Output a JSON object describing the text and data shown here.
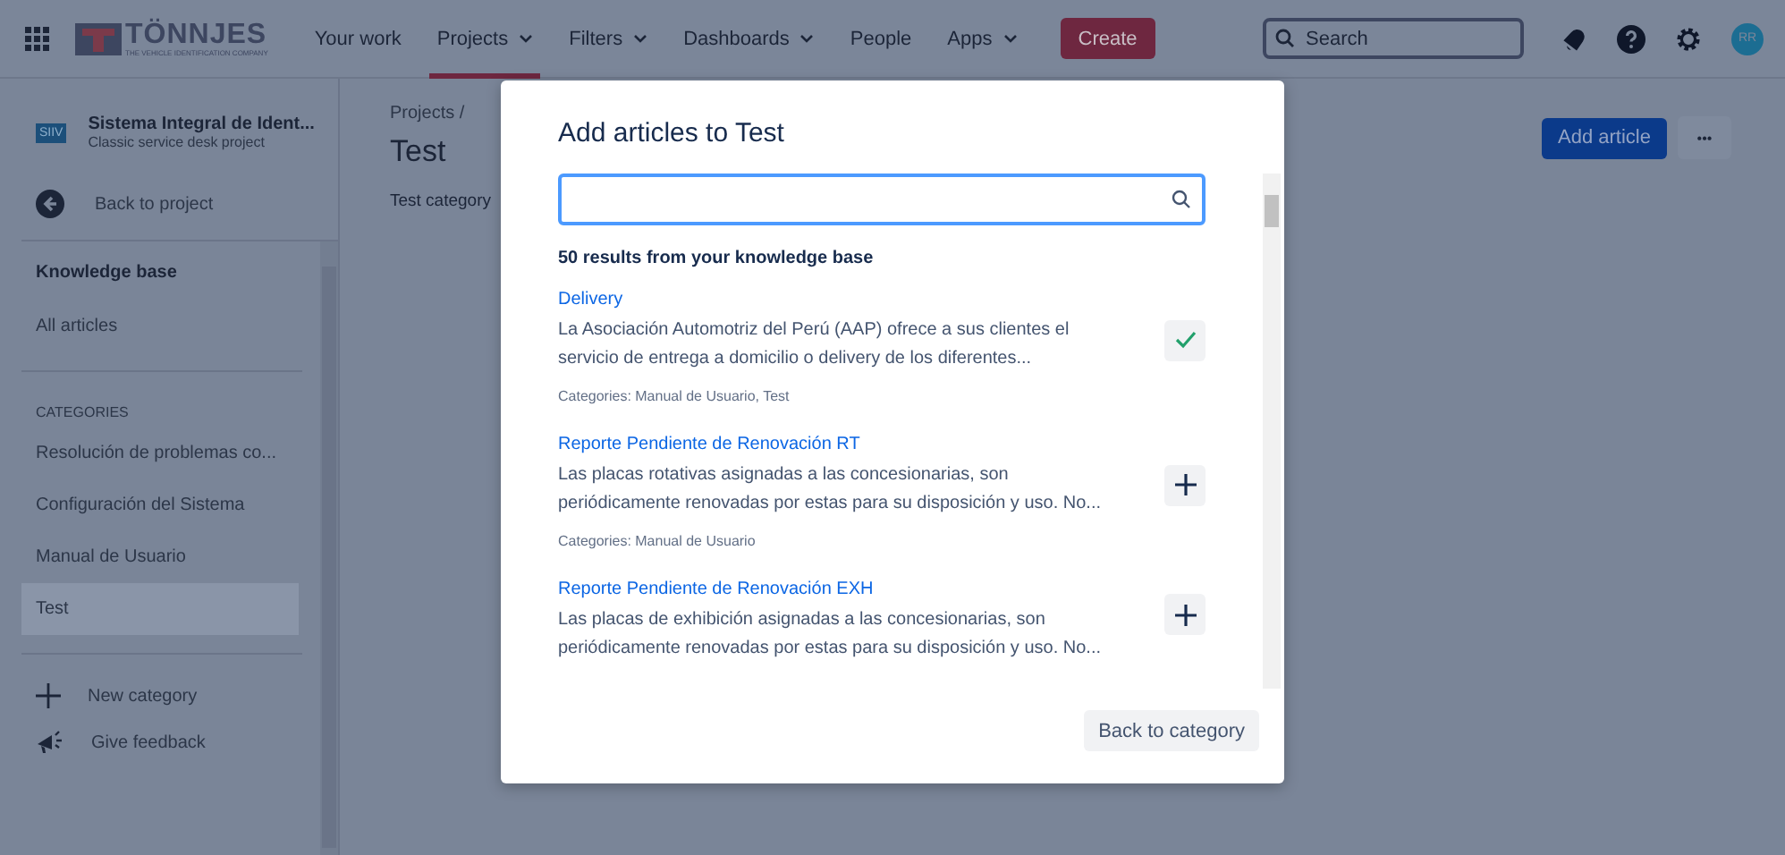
{
  "top_nav": {
    "logo": {
      "name": "TÖNNJES",
      "tagline": "THE VEHICLE IDENTIFICATION COMPANY"
    },
    "items": [
      {
        "label": "Your work",
        "has_menu": false,
        "selected": false
      },
      {
        "label": "Projects",
        "has_menu": true,
        "selected": true
      },
      {
        "label": "Filters",
        "has_menu": true,
        "selected": false
      },
      {
        "label": "Dashboards",
        "has_menu": true,
        "selected": false
      },
      {
        "label": "People",
        "has_menu": false,
        "selected": false
      },
      {
        "label": "Apps",
        "has_menu": true,
        "selected": false
      }
    ],
    "create_button": "Create",
    "search": {
      "placeholder": "Search"
    },
    "avatar": "RR"
  },
  "sidebar": {
    "project": {
      "badge": "SIIV",
      "name": "Sistema Integral de Ident...",
      "type": "Classic service desk project"
    },
    "back_link": "Back to project",
    "knowledge_heading": "Knowledge base",
    "knowledge_items": [
      {
        "label": "All articles",
        "selected": false
      }
    ],
    "categories_heading": "CATEGORIES",
    "categories": [
      {
        "label": "Resolución de problemas co...",
        "selected": false
      },
      {
        "label": "Configuración del Sistema",
        "selected": false
      },
      {
        "label": "Manual de Usuario",
        "selected": false
      },
      {
        "label": "Test",
        "selected": true
      }
    ],
    "new_category": "New category",
    "feedback": "Give feedback"
  },
  "page": {
    "breadcrumb": "Projects /",
    "title": "Test",
    "description": "Test category",
    "add_button": "Add article",
    "more_button": "•••"
  },
  "dialog": {
    "title": "Add articles to Test",
    "results_count": "50 results from your knowledge base",
    "articles": [
      {
        "title": "Delivery",
        "excerpt": "La Asociación Automotriz del Perú (AAP) ofrece a sus clientes el servicio de entrega a domicilio o delivery de los diferentes...",
        "categories": "Categories: Manual de Usuario, Test",
        "added": true
      },
      {
        "title": "Reporte Pendiente de Renovación RT",
        "excerpt": "Las placas rotativas asignadas a las concesionarias, son periódicamente renovadas por estas para su disposición y uso. No...",
        "categories": "Categories: Manual de Usuario",
        "added": false
      },
      {
        "title": "Reporte Pendiente de Renovación EXH",
        "excerpt": "Las placas de exhibición asignadas a las concesionarias, son periódicamente renovadas por estas para su disposición y uso. No...",
        "added": false
      }
    ],
    "back_button": "Back to category"
  }
}
